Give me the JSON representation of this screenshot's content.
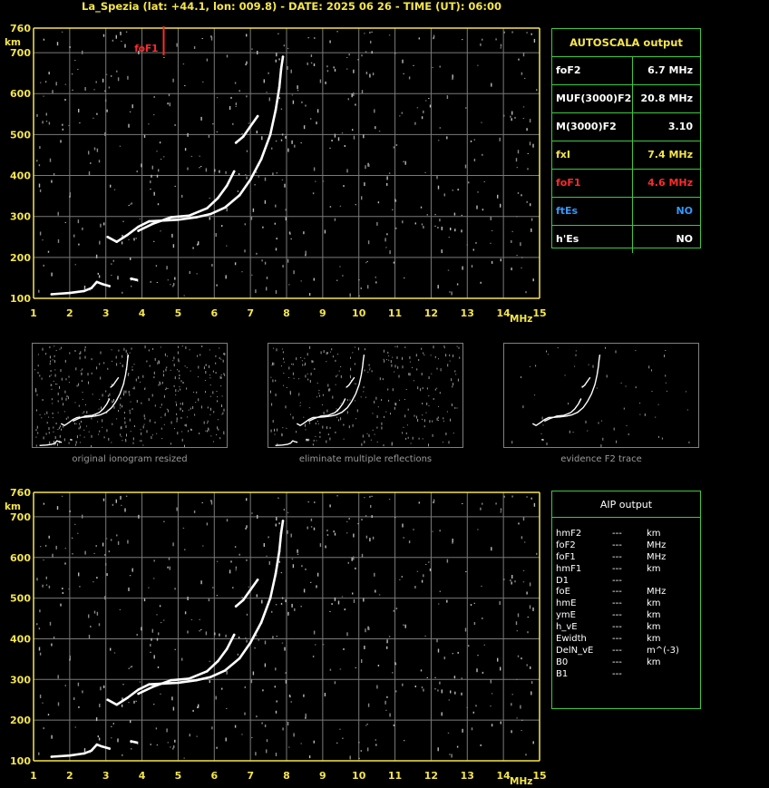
{
  "header": {
    "title": "La_Spezia (lat: +44.1, lon: 009.8) - DATE: 2025 06 26 - TIME (UT): 06:00"
  },
  "chart_data": [
    {
      "type": "scatter",
      "title": "",
      "xlabel": "MHz",
      "ylabel": "km",
      "xlim": [
        1,
        15
      ],
      "ylim": [
        100,
        760
      ],
      "x_ticks": [
        "1",
        "2",
        "3",
        "4",
        "5",
        "6",
        "7",
        "8",
        "9",
        "10",
        "11",
        "12",
        "13",
        "14",
        "15"
      ],
      "y_ticks": [
        "100",
        "200",
        "300",
        "400",
        "500",
        "600",
        "700",
        "760"
      ],
      "grid": true,
      "marker_label": "foF1",
      "marker_x": 4.6,
      "series": [
        {
          "values": [
            [
              1.5,
              110
            ],
            [
              2.0,
              113
            ],
            [
              2.4,
              118
            ],
            [
              2.6,
              125
            ],
            [
              2.75,
              140
            ],
            [
              2.9,
              135
            ],
            [
              3.1,
              130
            ]
          ]
        },
        {
          "values": [
            [
              3.05,
              250
            ],
            [
              3.3,
              238
            ],
            [
              3.6,
              255
            ],
            [
              3.9,
              275
            ],
            [
              4.2,
              288
            ],
            [
              4.6,
              290
            ],
            [
              5.0,
              292
            ],
            [
              5.5,
              298
            ],
            [
              5.9,
              306
            ],
            [
              6.3,
              322
            ],
            [
              6.7,
              352
            ],
            [
              7.0,
              390
            ],
            [
              7.3,
              440
            ],
            [
              7.55,
              500
            ],
            [
              7.7,
              560
            ],
            [
              7.8,
              615
            ],
            [
              7.85,
              660
            ],
            [
              7.9,
              690
            ]
          ]
        },
        {
          "values": [
            [
              3.9,
              265
            ],
            [
              4.3,
              282
            ],
            [
              4.8,
              298
            ],
            [
              5.3,
              302
            ],
            [
              5.8,
              320
            ],
            [
              6.1,
              345
            ],
            [
              6.35,
              375
            ],
            [
              6.55,
              410
            ]
          ]
        },
        {
          "values": [
            [
              6.6,
              480
            ],
            [
              6.8,
              495
            ],
            [
              7.0,
              520
            ],
            [
              7.2,
              545
            ]
          ]
        },
        {
          "values": [
            [
              3.7,
              148
            ],
            [
              3.85,
              145
            ]
          ]
        }
      ]
    },
    {
      "type": "scatter",
      "title": "",
      "xlabel": "MHz",
      "ylabel": "km",
      "xlim": [
        1,
        15
      ],
      "ylim": [
        100,
        760
      ],
      "x_ticks": [
        "1",
        "2",
        "3",
        "4",
        "5",
        "6",
        "7",
        "8",
        "9",
        "10",
        "11",
        "12",
        "13",
        "14",
        "15"
      ],
      "y_ticks": [
        "100",
        "200",
        "300",
        "400",
        "500",
        "600",
        "700",
        "760"
      ],
      "grid": true,
      "series": [
        {
          "values": [
            [
              1.5,
              110
            ],
            [
              2.0,
              113
            ],
            [
              2.4,
              118
            ],
            [
              2.6,
              125
            ],
            [
              2.75,
              140
            ],
            [
              2.9,
              135
            ],
            [
              3.1,
              130
            ]
          ]
        },
        {
          "values": [
            [
              3.05,
              250
            ],
            [
              3.3,
              238
            ],
            [
              3.6,
              255
            ],
            [
              3.9,
              275
            ],
            [
              4.2,
              288
            ],
            [
              4.6,
              290
            ],
            [
              5.0,
              292
            ],
            [
              5.5,
              298
            ],
            [
              5.9,
              306
            ],
            [
              6.3,
              322
            ],
            [
              6.7,
              352
            ],
            [
              7.0,
              390
            ],
            [
              7.3,
              440
            ],
            [
              7.55,
              500
            ],
            [
              7.7,
              560
            ],
            [
              7.8,
              615
            ],
            [
              7.85,
              660
            ],
            [
              7.9,
              690
            ]
          ]
        },
        {
          "values": [
            [
              3.9,
              265
            ],
            [
              4.3,
              282
            ],
            [
              4.8,
              298
            ],
            [
              5.3,
              302
            ],
            [
              5.8,
              320
            ],
            [
              6.1,
              345
            ],
            [
              6.35,
              375
            ],
            [
              6.55,
              410
            ]
          ]
        },
        {
          "values": [
            [
              6.6,
              480
            ],
            [
              6.8,
              495
            ],
            [
              7.0,
              520
            ],
            [
              7.2,
              545
            ]
          ]
        },
        {
          "values": [
            [
              3.7,
              148
            ],
            [
              3.85,
              145
            ]
          ]
        }
      ]
    }
  ],
  "autoscala": {
    "title": "AUTOSCALA output",
    "rows": [
      {
        "key": "foF2",
        "value": "6.7 MHz",
        "color": "#ffffff"
      },
      {
        "key": "MUF(3000)F2",
        "value": "20.8 MHz",
        "color": "#ffffff"
      },
      {
        "key": "M(3000)F2",
        "value": "3.10",
        "color": "#ffffff"
      },
      {
        "key": "fxI",
        "value": "7.4 MHz",
        "color": "#f5e64a"
      },
      {
        "key": "foF1",
        "value": "4.6 MHz",
        "color": "#ff2a2a"
      },
      {
        "key": "ftEs",
        "value": "NO",
        "color": "#3399ff"
      },
      {
        "key": "h'Es",
        "value": "NO",
        "color": "#ffffff"
      }
    ]
  },
  "thumbnails": [
    {
      "caption": "original ionogram resized"
    },
    {
      "caption": "eliminate multiple reflections"
    },
    {
      "caption": "evidence F2 trace"
    }
  ],
  "aip": {
    "title": "AIP output",
    "rows": [
      {
        "name": "hmF2",
        "dash": "---",
        "unit": "km"
      },
      {
        "name": "foF2",
        "dash": "---",
        "unit": "MHz"
      },
      {
        "name": "foF1",
        "dash": "---",
        "unit": "MHz"
      },
      {
        "name": "hmF1",
        "dash": "---",
        "unit": "km"
      },
      {
        "name": "D1",
        "dash": "---",
        "unit": ""
      },
      {
        "name": "foE",
        "dash": "---",
        "unit": "MHz"
      },
      {
        "name": "hmE",
        "dash": "---",
        "unit": "km"
      },
      {
        "name": "ymE",
        "dash": "---",
        "unit": "km"
      },
      {
        "name": "h_vE",
        "dash": "---",
        "unit": "km"
      },
      {
        "name": "Ewidth",
        "dash": "---",
        "unit": "km"
      },
      {
        "name": "DelN_vE",
        "dash": "---",
        "unit": "m^(-3)"
      },
      {
        "name": "B0",
        "dash": "---",
        "unit": "km"
      },
      {
        "name": "B1",
        "dash": "---",
        "unit": ""
      }
    ]
  },
  "colors": {
    "axis": "#f5e64a",
    "grid": "#7a7a7a",
    "panel_border": "#3fc83f",
    "trace": "#ffffff",
    "marker": "#ff2a2a",
    "thumb_border": "#808080"
  }
}
